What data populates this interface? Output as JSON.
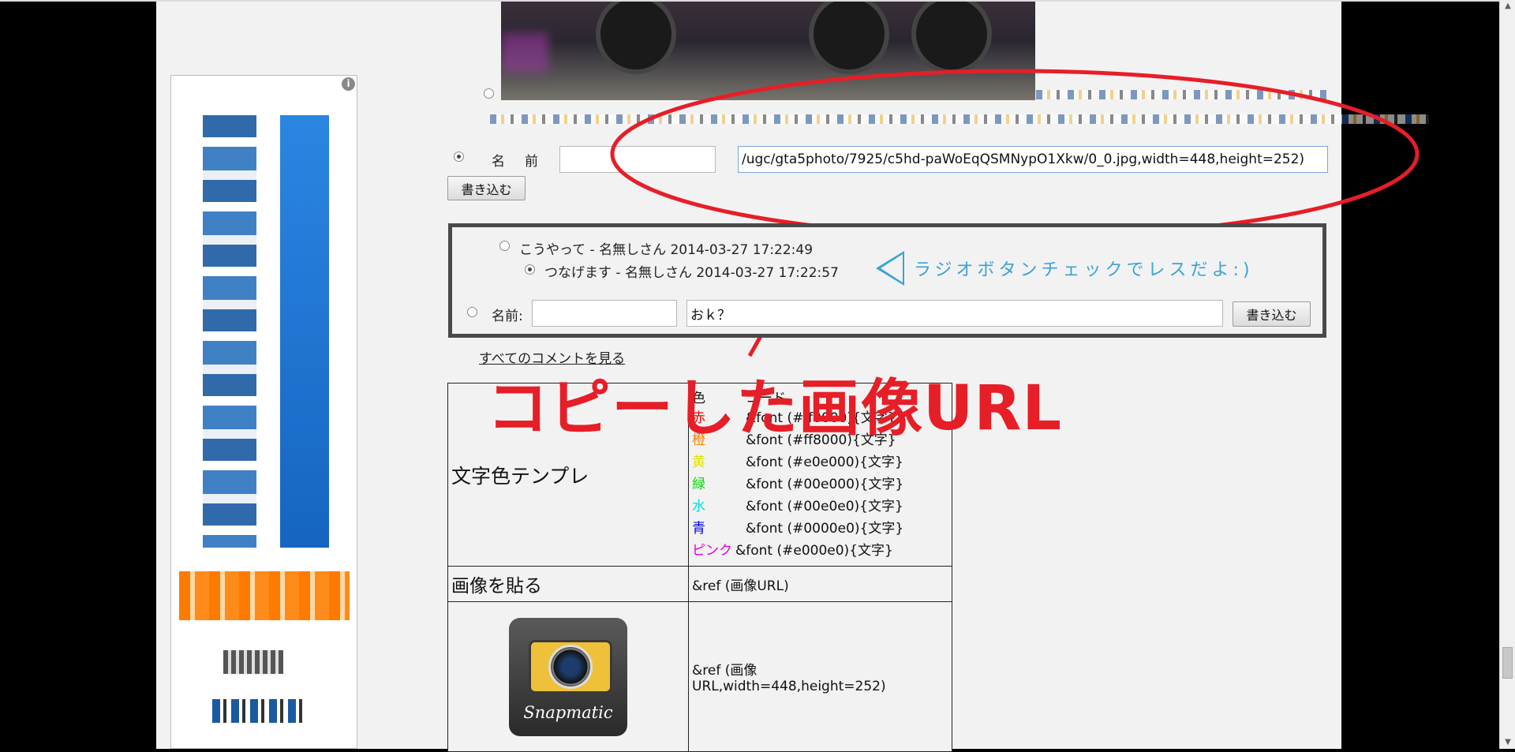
{
  "header_image": {
    "alt_icon": "car-photo"
  },
  "name_form": {
    "name_label": "名　前　:",
    "name_value": "",
    "url_value": "/ugc/gta5photo/7925/c5hd-paWoEqQSMNypO1Xkw/0_0.jpg,width=448,height=252)",
    "submit_label": "書き込む"
  },
  "comments": {
    "items": [
      {
        "text": "こうやって - 名無しさん 2014-03-27 17:22:49"
      },
      {
        "text": "つなげます - 名無しさん 2014-03-27 17:22:57"
      }
    ],
    "name_label": "名前:",
    "name_value": "",
    "comment_value": "おｋ？",
    "submit_label": "書き込む",
    "hint": "ラジオボタンチェックでレスだよ:)"
  },
  "all_comments_link": "すべてのコメントを見る",
  "annotation_title": "コピーした画像URL",
  "template_table": {
    "row1_label": "文字色テンプレ",
    "header": {
      "col1": "色",
      "col2": "コード"
    },
    "colors": [
      {
        "name": "赤",
        "color": "#ff0000",
        "code": "&font (#ff0000){文字}"
      },
      {
        "name": "橙",
        "color": "#ff8000",
        "code": "&font (#ff8000){文字}"
      },
      {
        "name": "黄",
        "color": "#e0e000",
        "code": "&font (#e0e000){文字}"
      },
      {
        "name": "緑",
        "color": "#00e000",
        "code": "&font (#00e000){文字}"
      },
      {
        "name": "水",
        "color": "#00e0e0",
        "code": "&font (#00e0e0){文字}"
      },
      {
        "name": "青",
        "color": "#0000e0",
        "code": "&font (#0000e0){文字}"
      },
      {
        "name": "ピンク",
        "color": "#e000e0",
        "code": "&font (#e000e0){文字}"
      }
    ],
    "row2_label": "画像を貼る",
    "row2_code": "&ref (画像URL)",
    "row3_code": "&ref (画像URL,width=448,height=252)",
    "snapmatic_label": "Snapmatic"
  },
  "sidebar": {
    "info_icon": "info-icon"
  },
  "colors": {
    "annotation_red": "#e61e28",
    "hint_blue": "#3aa3d6",
    "box_border": "#4a4a4a"
  }
}
